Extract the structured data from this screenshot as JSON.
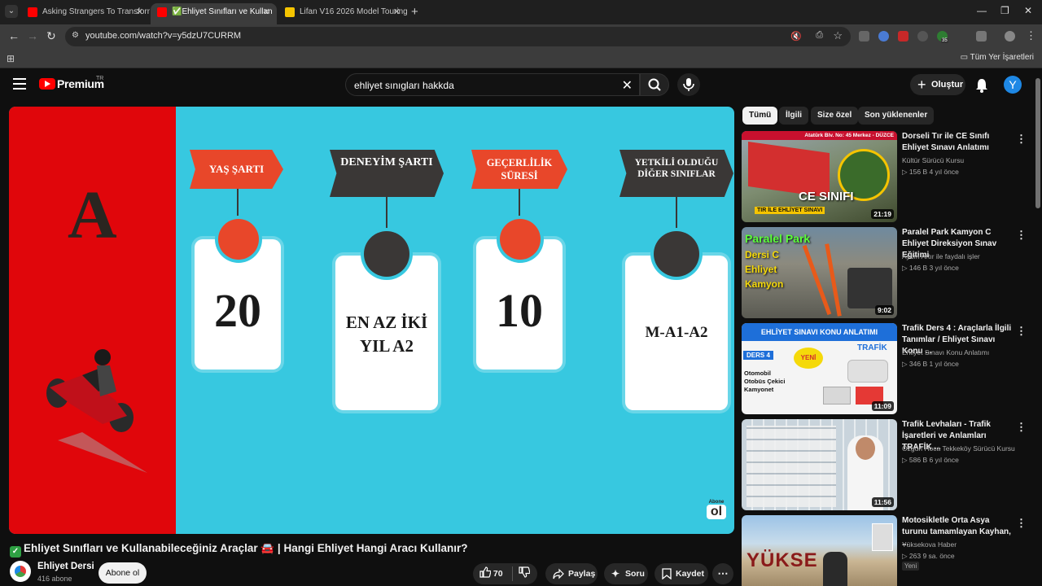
{
  "browser": {
    "tabs": [
      {
        "title": "Asking Strangers To Transform",
        "active": false
      },
      {
        "title": "✅Ehliyet Sınıfları ve Kullan",
        "active": true
      },
      {
        "title": "Lifan V16 2026 Model Touring",
        "active": false
      }
    ],
    "url": "youtube.com/watch?v=y5dzU7CURRM",
    "extension_badge": "35",
    "all_bookmarks": "Tüm Yer İşaretleri"
  },
  "header": {
    "logo_text": "Premium",
    "country": "TR",
    "search_query": "ehliyet sınıgları hakkda",
    "create_label": "Oluştur",
    "avatar_letter": "Y"
  },
  "video_frame": {
    "letter": "A",
    "columns": [
      {
        "banner": "YAŞ ŞARTI",
        "value": "20"
      },
      {
        "banner": "DENEYİM ŞARTI",
        "value": "EN AZ İKİ YIL A2"
      },
      {
        "banner": "GEÇERLİLİK SÜRESİ",
        "value": "10"
      },
      {
        "banner": "YETKİLİ OLDUĞU DİĞER SINIFLAR",
        "value": "M-A1-A2"
      }
    ],
    "watermark_small": "Abone",
    "watermark_big": "ol"
  },
  "video": {
    "title": "Ehliyet Sınıfları ve Kullanabileceğiniz Araçlar 🚘 | Hangi Ehliyet Hangi Aracı Kullanır?",
    "channel": "Ehliyet Dersi",
    "subscribers": "416 abone",
    "subscribe_label": "Abone ol",
    "likes": "70",
    "share_label": "Paylaş",
    "ask_label": "Soru",
    "save_label": "Kaydet"
  },
  "sidebar": {
    "chips": [
      "Tümü",
      "İlgili",
      "Size özel",
      "Son yüklenenler"
    ],
    "recommendations": [
      {
        "title": "Dorseli Tır ile CE Sınıfı Ehliyet Sınavı Anlatımı",
        "channel": "Kültür Sürücü Kursu",
        "meta": "▷ 156 B   4 yıl önce",
        "duration": "21:19",
        "thumb_caption": "CE SINIFI",
        "thumb_sub": "TIR İLE EHLİYET SINAVI",
        "thumb_top": "Atatürk Blv. No: 45 Merkez - DÜZCE"
      },
      {
        "title": "Paralel Park Kamyon C Ehliyet Direksiyon Sınav Eğitimi",
        "channel": "Aydın Artır ile faydalı işler",
        "meta": "▷ 146 B   3 yıl önce",
        "duration": "9:02",
        "thumb_caption": "Paralel Park",
        "thumb_sub": "Dersi C Ehliyet Kamyon"
      },
      {
        "title": "Trafik Ders 4 : Araçlarla İlgili Tanımlar / Ehliyet Sınavı Konu ...",
        "channel": "Ehliyet Sınavı Konu Anlatımı",
        "meta": "▷ 346 B   1 yıl önce",
        "duration": "11:09",
        "thumb_caption": "EHLİYET SINAVI KONU ANLATIMI",
        "thumb_sub": "Otomobil Otobüs Çekici Kamyonet",
        "thumb_badge": "DERS 4",
        "thumb_new": "YENİ",
        "thumb_right": "TRAFİK"
      },
      {
        "title": "Trafik Levhaları - Trafik İşaretleri ve Anlamları TRAFİK ...",
        "channel": "Özgün Hoca Tekkeköy Sürücü Kursu",
        "meta": "▷ 586 B   6 yıl önce",
        "duration": "11:56"
      },
      {
        "title": "Motosikletle Orta Asya turunu tamamlayan Kayhan, ...",
        "channel": "Yüksekova Haber",
        "meta": "▷ 263   9 sa. önce",
        "badge": "Yeni",
        "thumb_caption": "YÜKSE"
      }
    ]
  },
  "colors": {
    "video_bg": "#37c8e0",
    "red_panel": "#e0060b",
    "banner_red": "#e8472a",
    "banner_dark": "#3a3736"
  }
}
